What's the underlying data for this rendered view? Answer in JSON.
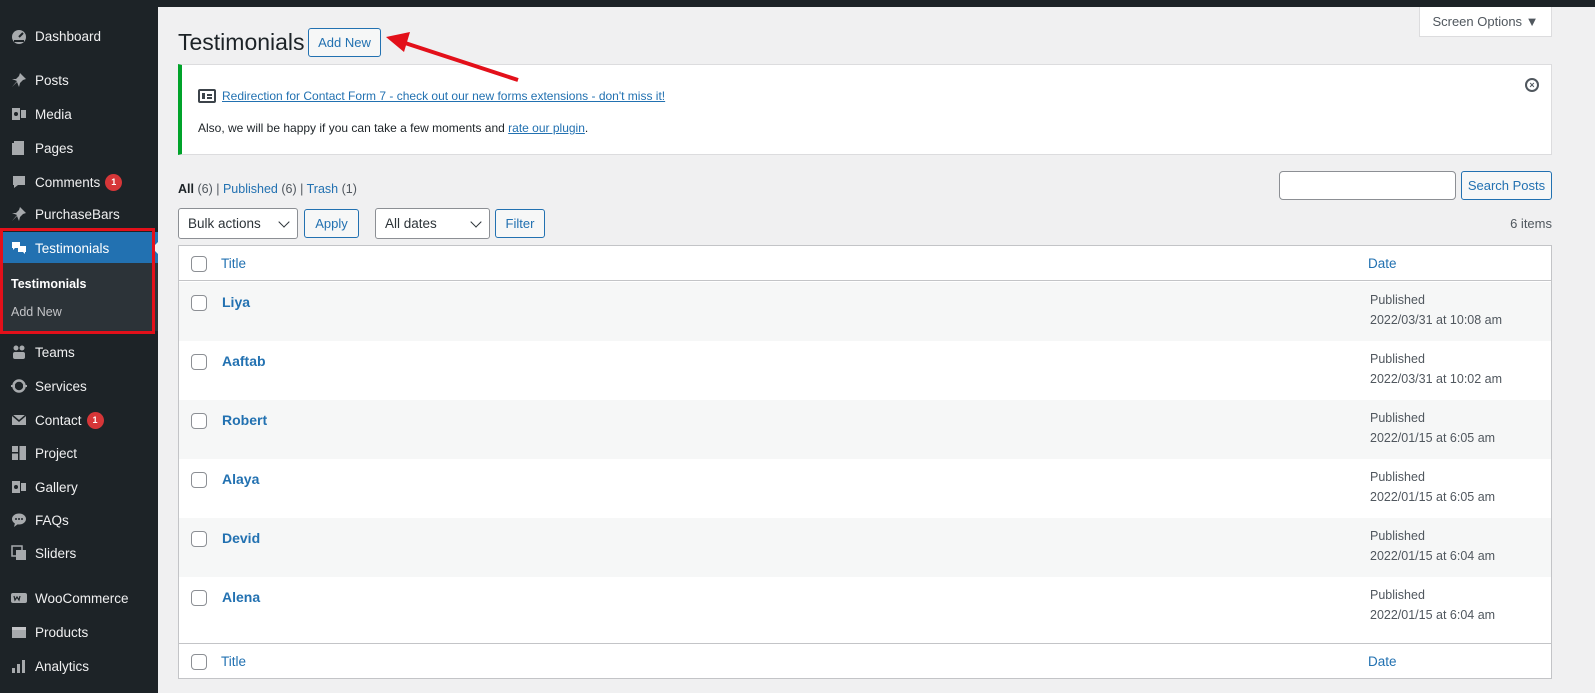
{
  "sidebar": {
    "items": [
      {
        "label": "Dashboard",
        "icon": "dashboard-icon",
        "badge": ""
      },
      {
        "label": "Posts",
        "icon": "pin-icon",
        "badge": ""
      },
      {
        "label": "Media",
        "icon": "media-icon",
        "badge": ""
      },
      {
        "label": "Pages",
        "icon": "pages-icon",
        "badge": ""
      },
      {
        "label": "Comments",
        "icon": "comments-icon",
        "badge": "1"
      },
      {
        "label": "PurchaseBars",
        "icon": "pin-icon",
        "badge": ""
      },
      {
        "label": "Testimonials",
        "icon": "testimonial-icon",
        "badge": ""
      },
      {
        "label": "Teams",
        "icon": "teams-icon",
        "badge": ""
      },
      {
        "label": "Services",
        "icon": "services-icon",
        "badge": ""
      },
      {
        "label": "Contact",
        "icon": "mail-icon",
        "badge": "1"
      },
      {
        "label": "Project",
        "icon": "project-icon",
        "badge": ""
      },
      {
        "label": "Gallery",
        "icon": "gallery-icon",
        "badge": ""
      },
      {
        "label": "FAQs",
        "icon": "faq-icon",
        "badge": ""
      },
      {
        "label": "Sliders",
        "icon": "sliders-icon",
        "badge": ""
      },
      {
        "label": "WooCommerce",
        "icon": "woocommerce-icon",
        "badge": ""
      },
      {
        "label": "Products",
        "icon": "products-icon",
        "badge": ""
      },
      {
        "label": "Analytics",
        "icon": "analytics-icon",
        "badge": ""
      }
    ],
    "submenu": {
      "current": "Testimonials",
      "add_new": "Add New"
    }
  },
  "header": {
    "title": "Testimonials",
    "add_new": "Add New",
    "screen_options": "Screen Options ▼"
  },
  "notice": {
    "link": "Redirection for Contact Form 7 - check out our new forms extensions - don't miss it!",
    "text_before": "Also, we will be happy if you can take a few moments and ",
    "text_link": "rate our plugin",
    "text_after": "."
  },
  "filters": {
    "all": "All",
    "all_count": "(6)",
    "published": "Published",
    "published_count": "(6)",
    "trash": "Trash",
    "trash_count": "(1)",
    "sep": "|",
    "search_button": "Search Posts",
    "bulk_actions": "Bulk actions",
    "apply": "Apply",
    "all_dates": "All dates",
    "filter": "Filter",
    "items_count": "6 items"
  },
  "table": {
    "col_title": "Title",
    "col_date": "Date",
    "rows": [
      {
        "title": "Liya",
        "status": "Published",
        "date": "2022/03/31 at 10:08 am"
      },
      {
        "title": "Aaftab",
        "status": "Published",
        "date": "2022/03/31 at 10:02 am"
      },
      {
        "title": "Robert",
        "status": "Published",
        "date": "2022/01/15 at 6:05 am"
      },
      {
        "title": "Alaya",
        "status": "Published",
        "date": "2022/01/15 at 6:05 am"
      },
      {
        "title": "Devid",
        "status": "Published",
        "date": "2022/01/15 at 6:04 am"
      },
      {
        "title": "Alena",
        "status": "Published",
        "date": "2022/01/15 at 6:04 am"
      }
    ]
  },
  "colors": {
    "sidebar_bg": "#1d2327",
    "active_blue": "#2271b1",
    "annotation_red": "#e3101a",
    "notice_green": "#00a32a"
  }
}
